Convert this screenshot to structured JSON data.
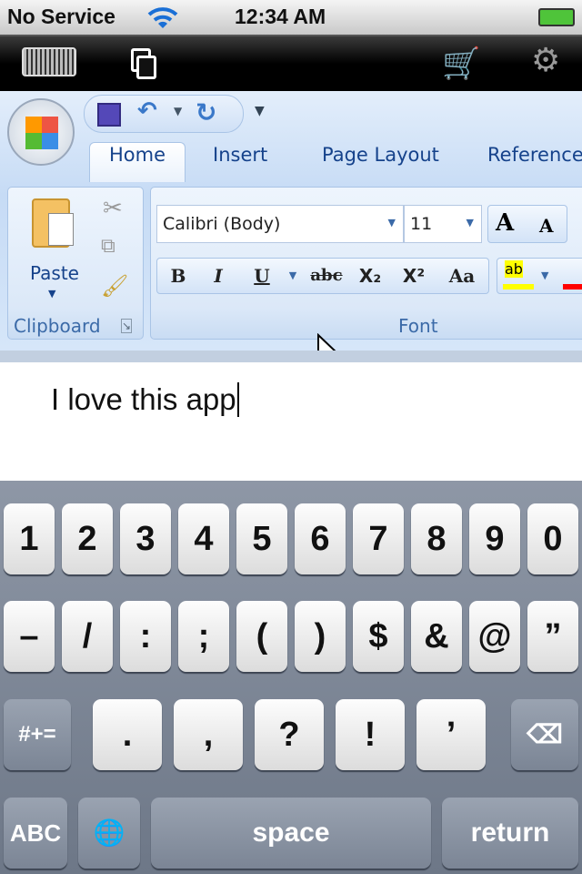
{
  "status": {
    "carrier": "No Service",
    "time": "12:34 AM",
    "battery": "charging"
  },
  "toolbar": {
    "icons": [
      "keyboard-icon",
      "windows-icon",
      "cart-icon",
      "gear-icon"
    ]
  },
  "ribbon": {
    "tabs": [
      "Home",
      "Insert",
      "Page Layout",
      "Reference"
    ],
    "active_tab": "Home",
    "clipboard": {
      "paste": "Paste",
      "label": "Clipboard"
    },
    "font": {
      "name": "Calibri (Body)",
      "size": "11",
      "label": "Font",
      "buttons": [
        "B",
        "I",
        "U",
        "abc",
        "X₂",
        "X²",
        "Aa"
      ],
      "grow": "A",
      "shrink": "A",
      "highlight": "ab"
    }
  },
  "document": {
    "text": "I love this app"
  },
  "keyboard": {
    "row1": [
      "1",
      "2",
      "3",
      "4",
      "5",
      "6",
      "7",
      "8",
      "9",
      "0"
    ],
    "row2": [
      "–",
      "/",
      ":",
      ";",
      "(",
      ")",
      "$",
      "&",
      "@",
      "”"
    ],
    "row3": [
      ".",
      ",",
      "?",
      "!",
      "’"
    ],
    "symbols": "#+=",
    "abc": "ABC",
    "space": "space",
    "return": "return"
  },
  "colors": {
    "ribbon_text": "#15428b",
    "highlight": "#ffff00",
    "font_color": "#ff0000"
  }
}
